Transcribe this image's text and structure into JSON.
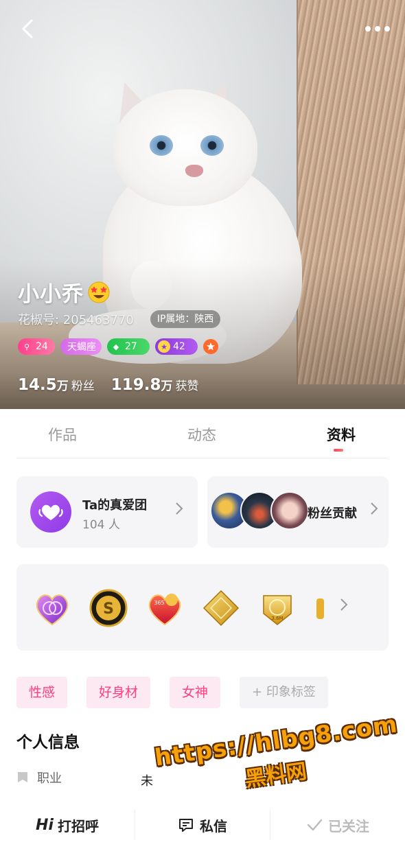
{
  "profile": {
    "name": "小小乔",
    "huajiao_id": "花椒号: 205463770",
    "ip_location": "IP属地：陕西",
    "badges": {
      "fans_level": "24",
      "zodiac": "天蝎座",
      "gem_level": "27",
      "vip_level": "42"
    },
    "stats": {
      "fans_num": "14.5",
      "fans_unit": "万",
      "fans_label": "粉丝",
      "likes_num": "119.8",
      "likes_unit": "万",
      "likes_label": "获赞"
    }
  },
  "tabs": [
    "作品",
    "动态",
    "资料"
  ],
  "active_tab": "资料",
  "fan_club": {
    "title": "Ta的真爱团",
    "count": "104 人"
  },
  "fan_contribution": {
    "title": "粉丝贡献"
  },
  "medals": {
    "third_medal_label": "365",
    "fifth_medal_label": "3.6M"
  },
  "tags": [
    "性感",
    "好身材",
    "女神"
  ],
  "add_tag_label": "+ 印象标签",
  "personal_info": {
    "title": "个人信息",
    "job_label": "职业",
    "job_value": "未"
  },
  "watermark": {
    "url": "https://hlbg8.com",
    "name": "黑料网"
  },
  "bottom_bar": {
    "greet_prefix": "Hi",
    "greet_label": "打招呼",
    "message_label": "私信",
    "follow_label": "已关注"
  },
  "colors": {
    "accent": "#ff3d7f",
    "tag_bg": "#fde9f1",
    "fan_club_purple": "#a34cf0"
  }
}
